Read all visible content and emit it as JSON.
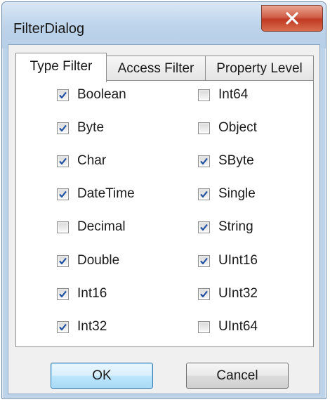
{
  "window": {
    "title": "FilterDialog"
  },
  "tabs": [
    {
      "label": "Type Filter",
      "active": true
    },
    {
      "label": "Access Filter",
      "active": false
    },
    {
      "label": "Property Level",
      "active": false
    }
  ],
  "checkboxes": [
    {
      "label": "Boolean",
      "checked": true
    },
    {
      "label": "Int64",
      "checked": false
    },
    {
      "label": "Byte",
      "checked": true
    },
    {
      "label": "Object",
      "checked": false
    },
    {
      "label": "Char",
      "checked": true
    },
    {
      "label": "SByte",
      "checked": true
    },
    {
      "label": "DateTime",
      "checked": true
    },
    {
      "label": "Single",
      "checked": true
    },
    {
      "label": "Decimal",
      "checked": false
    },
    {
      "label": "String",
      "checked": true
    },
    {
      "label": "Double",
      "checked": true
    },
    {
      "label": "UInt16",
      "checked": true
    },
    {
      "label": "Int16",
      "checked": true
    },
    {
      "label": "UInt32",
      "checked": true
    },
    {
      "label": "Int32",
      "checked": true
    },
    {
      "label": "UInt64",
      "checked": false
    }
  ],
  "buttons": {
    "ok": "OK",
    "cancel": "Cancel"
  },
  "icons": {
    "close": "close-icon",
    "check": "check-icon"
  },
  "colors": {
    "close_button": "#c9442b",
    "check_mark": "#1f4fa0",
    "default_button_border": "#3c7fb1"
  }
}
